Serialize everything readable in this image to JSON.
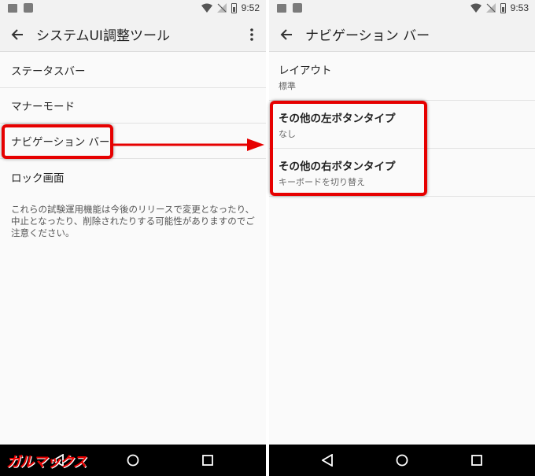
{
  "left": {
    "status": {
      "time": "9:52"
    },
    "title": "システムUI調整ツール",
    "items": [
      {
        "label": "ステータスバー"
      },
      {
        "label": "マナーモード"
      },
      {
        "label": "ナビゲーション バー"
      },
      {
        "label": "ロック画面"
      }
    ],
    "note": "これらの試験運用機能は今後のリリースで変更となったり、中止となったり、削除されたりする可能性がありますのでご注意ください。"
  },
  "right": {
    "status": {
      "time": "9:53"
    },
    "title": "ナビゲーション バー",
    "items": [
      {
        "title": "レイアウト",
        "subtitle": "標準"
      },
      {
        "title": "その他の左ボタンタイプ",
        "subtitle": "なし"
      },
      {
        "title": "その他の右ボタンタイプ",
        "subtitle": "キーボードを切り替え"
      }
    ]
  },
  "icons": {
    "back": "arrow-left-icon",
    "more": "more-vert-icon",
    "nav_back": "triangle-back-icon",
    "nav_home": "circle-home-icon",
    "nav_recents": "square-recents-icon"
  },
  "colors": {
    "highlight": "#e60000",
    "navbar": "#000000",
    "appbar": "#f2f2f2"
  },
  "watermark": "ガルマックス"
}
